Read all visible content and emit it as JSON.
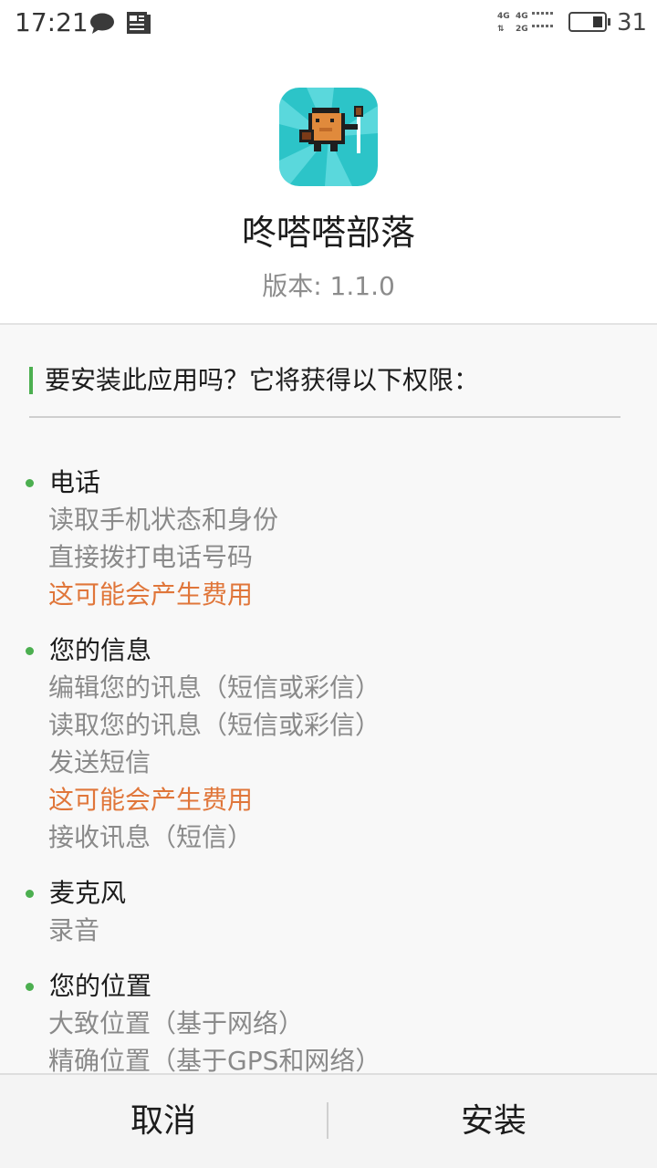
{
  "status_bar": {
    "time": "17:21",
    "icons": [
      "message-icon",
      "news-icon"
    ],
    "network": {
      "top_label_1": "4G",
      "top_label_2": "4G",
      "bottom_label": "2G"
    },
    "battery_level": "31"
  },
  "app": {
    "icon": "app-icon-pixel-character",
    "name": "咚嗒嗒部落",
    "version_label": "版本:",
    "version_value": "1.1.0"
  },
  "permissions": {
    "question": "要安装此应用吗？它将获得以下权限：",
    "groups": [
      {
        "title": "电话",
        "items": [
          {
            "text": "读取手机状态和身份",
            "warning": false
          },
          {
            "text": "直接拨打电话号码",
            "warning": false
          },
          {
            "text": "这可能会产生费用",
            "warning": true
          }
        ]
      },
      {
        "title": "您的信息",
        "items": [
          {
            "text": "编辑您的讯息（短信或彩信）",
            "warning": false
          },
          {
            "text": "读取您的讯息（短信或彩信）",
            "warning": false
          },
          {
            "text": "发送短信",
            "warning": false
          },
          {
            "text": "这可能会产生费用",
            "warning": true
          },
          {
            "text": "接收讯息（短信）",
            "warning": false
          }
        ]
      },
      {
        "title": "麦克风",
        "items": [
          {
            "text": "录音",
            "warning": false
          }
        ]
      },
      {
        "title": "您的位置",
        "items": [
          {
            "text": "大致位置（基于网络）",
            "warning": false
          },
          {
            "text": "精确位置（基于GPS和网络）",
            "warning": false
          }
        ]
      }
    ]
  },
  "actions": {
    "cancel_label": "取消",
    "install_label": "安装"
  },
  "colors": {
    "accent": "#4caf50",
    "warning": "#e0763a",
    "icon_background": "#2cc4c8"
  }
}
